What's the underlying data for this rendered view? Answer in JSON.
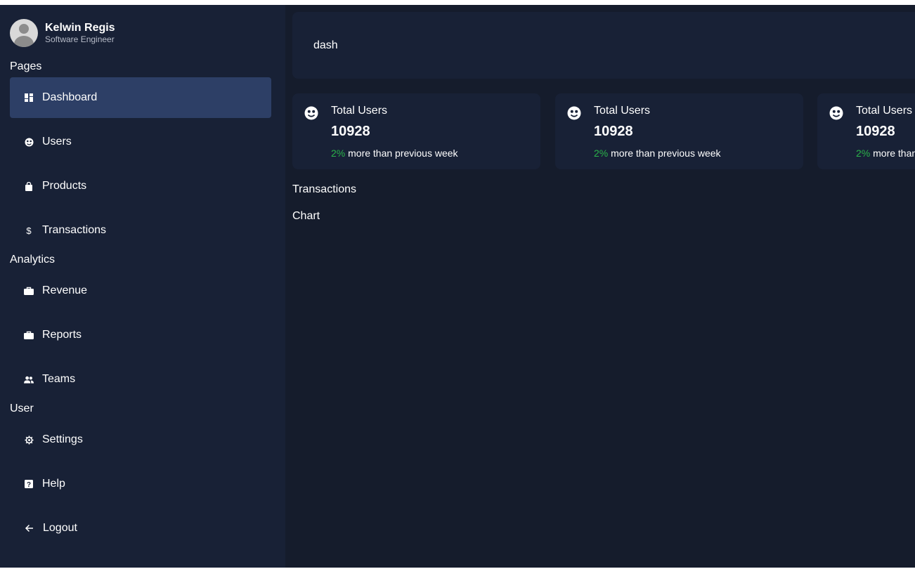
{
  "user": {
    "name": "Kelwin Regis",
    "role": "Software Engineer"
  },
  "sidebar": {
    "sections": [
      {
        "title": "Pages",
        "items": [
          {
            "label": "Dashboard",
            "icon": "dashboard-icon",
            "active": true
          },
          {
            "label": "Users",
            "icon": "users-face-icon"
          },
          {
            "label": "Products",
            "icon": "shopping-bag-icon"
          },
          {
            "label": "Transactions",
            "icon": "dollar-icon"
          }
        ]
      },
      {
        "title": "Analytics",
        "items": [
          {
            "label": "Revenue",
            "icon": "briefcase-icon"
          },
          {
            "label": "Reports",
            "icon": "briefcase-icon"
          },
          {
            "label": "Teams",
            "icon": "people-icon"
          }
        ]
      },
      {
        "title": "User",
        "items": [
          {
            "label": "Settings",
            "icon": "gear-icon"
          },
          {
            "label": "Help",
            "icon": "help-icon"
          },
          {
            "label": "Logout",
            "icon": "arrow-left-icon"
          }
        ]
      }
    ]
  },
  "topbar": {
    "title": "dash"
  },
  "cards": [
    {
      "title": "Total Users",
      "value": "10928",
      "percent": "2%",
      "detail": "more than previous week"
    },
    {
      "title": "Total Users",
      "value": "10928",
      "percent": "2%",
      "detail": "more than previous week"
    },
    {
      "title": "Total Users",
      "value": "10928",
      "percent": "2%",
      "detail": "more than previous week"
    }
  ],
  "main": {
    "transactions_label": "Transactions",
    "chart_label": "Chart"
  },
  "colors": {
    "background": "#151c2c",
    "panel": "#182136",
    "active": "#2d3f66",
    "positive": "#2bb34a"
  }
}
